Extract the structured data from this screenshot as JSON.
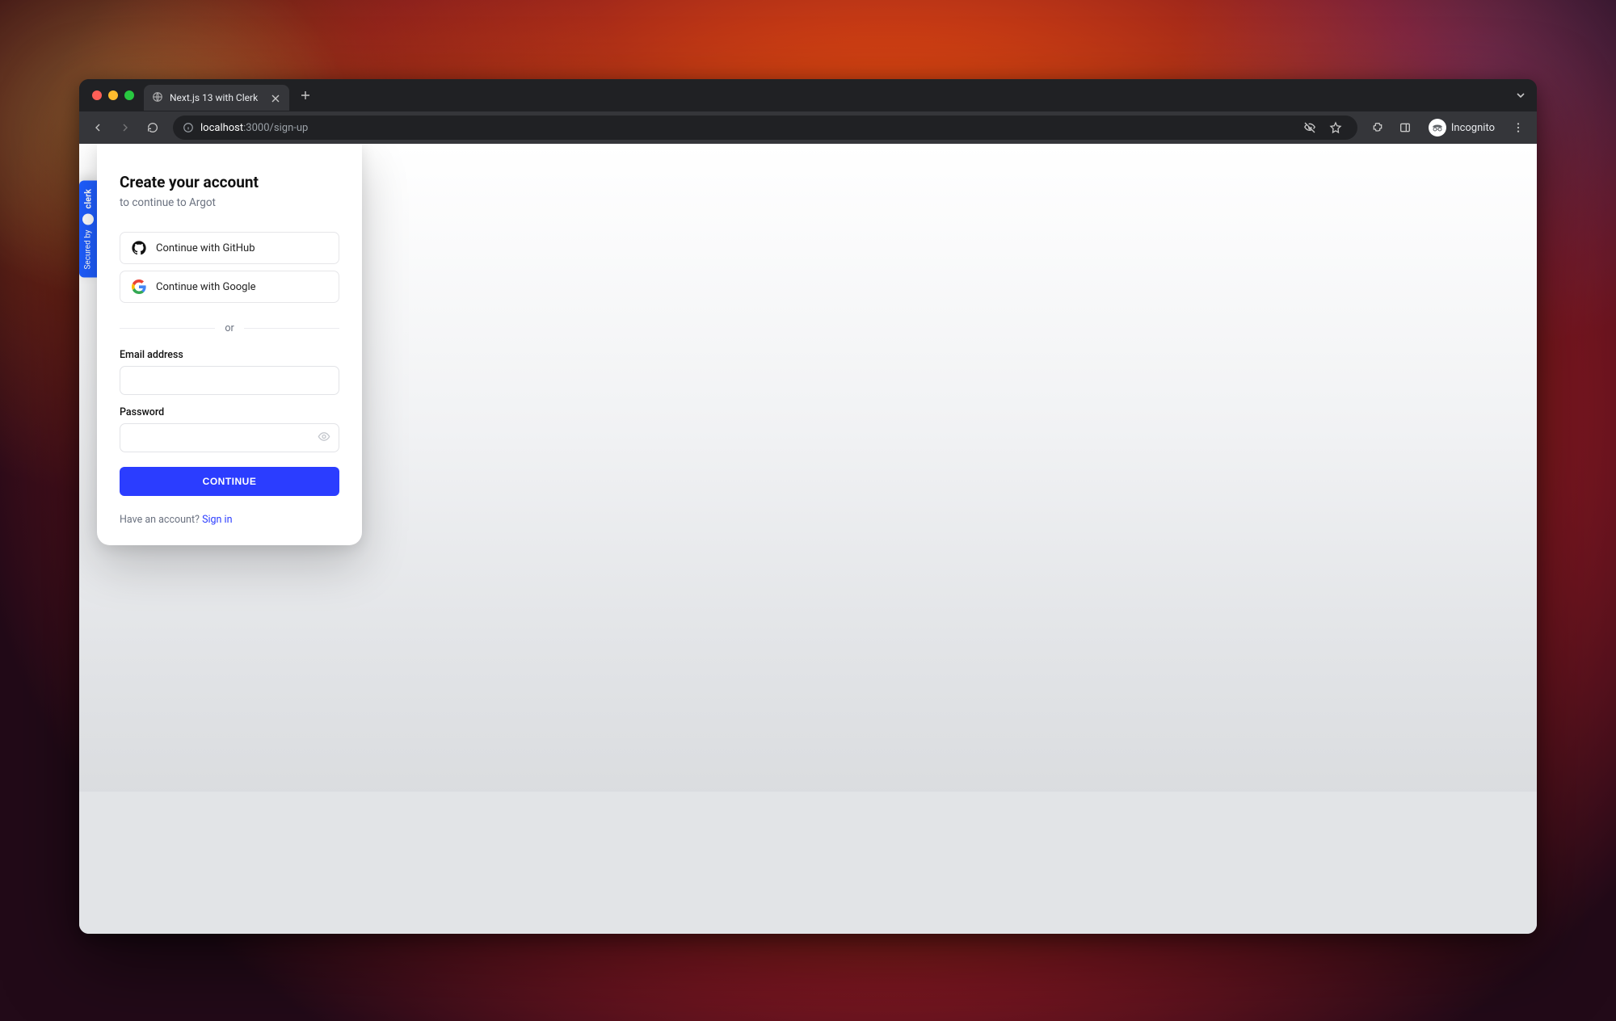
{
  "browser": {
    "tab_title": "Next.js 13 with Clerk",
    "url_host": "localhost",
    "url_rest": ":3000/sign-up",
    "incognito_label": "Incognito"
  },
  "clerk_badge": {
    "prefix": "Secured by",
    "brand": "clerk"
  },
  "signup": {
    "title": "Create your account",
    "subtitle": "to continue to Argot",
    "oauth": {
      "github": "Continue with GitHub",
      "google": "Continue with Google"
    },
    "divider": "or",
    "labels": {
      "email": "Email address",
      "password": "Password"
    },
    "submit": "CONTINUE",
    "have_account": "Have an account?",
    "signin": "Sign in"
  }
}
